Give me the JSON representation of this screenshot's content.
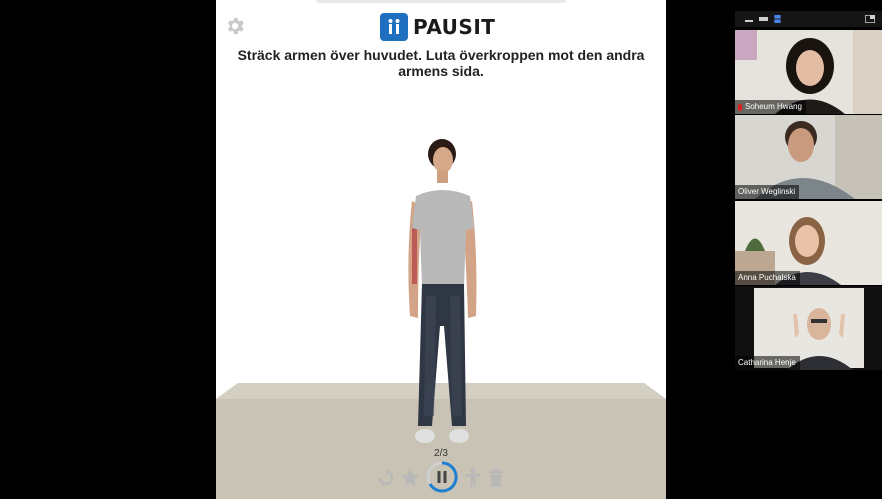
{
  "app": {
    "brand": "PAUSIT",
    "instruction": "Sträck armen över huvudet. Luta överkroppen mot den andra armens sida.",
    "progress": "2/3",
    "controls": {
      "replay": "replay-icon",
      "favorite": "star-icon",
      "pause": "pause-icon",
      "exercise_type": "person-icon",
      "delete": "trash-icon"
    },
    "settings_icon": "gear-icon",
    "colors": {
      "brand": "#1e6fc0",
      "accent": "#1e7fd0",
      "floor": "#c8c3b5"
    }
  },
  "call": {
    "participants": [
      {
        "name": "Soheum Hwang",
        "muted": true
      },
      {
        "name": "Oliver Weglinski",
        "muted": false
      },
      {
        "name": "Anna Puchalska",
        "muted": false
      },
      {
        "name": "Catharina Henje",
        "muted": false,
        "active_speaker": true
      }
    ],
    "speaker_highlight_color": "#d8c34a"
  }
}
